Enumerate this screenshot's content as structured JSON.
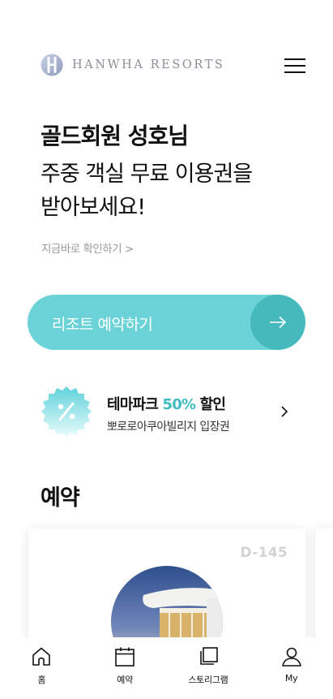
{
  "header": {
    "logo_text": "HANWHA RESORTS",
    "logo_icon": "hanwha-logo-icon",
    "menu_icon": "hamburger-menu-icon"
  },
  "hero": {
    "greeting": "골드회원 성호님",
    "promo_line1": "주중 객실 무료 이용권을",
    "promo_line2": "받아보세요!",
    "check_link": "지금바로 확인하기  >"
  },
  "reserve_button": {
    "label": "리조트 예약하기",
    "icon": "arrow-right-icon"
  },
  "discount": {
    "title_prefix": "테마파크 ",
    "title_highlight": "50%",
    "title_suffix": " 할인",
    "subtitle": "뽀로로아쿠아빌리지 입장권",
    "icon": "percent-badge-icon",
    "chevron_icon": "chevron-right-icon"
  },
  "reservation": {
    "section_title": "예약",
    "card": {
      "dday": "D-145"
    }
  },
  "tabbar": {
    "items": [
      {
        "label": "홈",
        "icon": "home-icon"
      },
      {
        "label": "예약",
        "icon": "calendar-icon"
      },
      {
        "label": "스토리그램",
        "icon": "stacked-pages-icon"
      },
      {
        "label": "My",
        "icon": "person-icon"
      }
    ]
  },
  "colors": {
    "accent": "#6bd3d8",
    "accent_dark": "#46b9bd",
    "highlight_text": "#3fbcc2",
    "muted_text": "#9a9a9a"
  }
}
